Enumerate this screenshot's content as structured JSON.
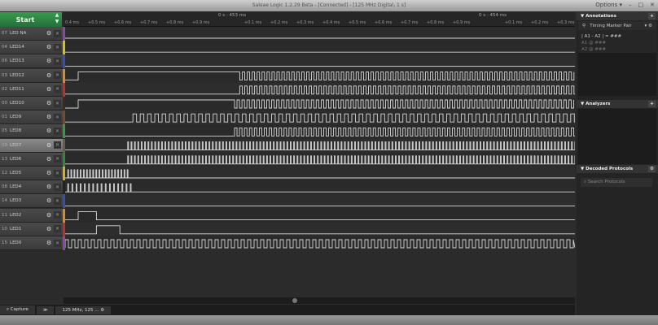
{
  "window": {
    "title": "Saleae Logic 1.2.29 Beta - [Connected] - [125 MHz Digital, 1 s]",
    "options_label": "Options ▾",
    "minimize": "–",
    "maximize": "□",
    "close": "✕"
  },
  "start_button": {
    "label": "Start"
  },
  "ruler": {
    "markers": [
      "0 s : 453 ms",
      "0 s : 454 ms"
    ],
    "ticks": [
      "0.4 ms",
      "+0.5 ms",
      "+0.6 ms",
      "+0.7 ms",
      "+0.8 ms",
      "+0.9 ms",
      "+0.1 ms",
      "+0.2 ms",
      "+0.3 ms",
      "+0.4 ms",
      "+0.5 ms",
      "+0.6 ms",
      "+0.7 ms",
      "+0.8 ms",
      "+0.9 ms",
      "+0.1 ms",
      "+0.2 ms",
      "+0.3 ms"
    ]
  },
  "channels": [
    {
      "num": "07",
      "name": "LED NA",
      "color": "#8e44ad",
      "wave": {
        "kind": "flat"
      }
    },
    {
      "num": "04",
      "name": "LED14",
      "color": "#d4c21a",
      "wave": {
        "kind": "flat"
      }
    },
    {
      "num": "06",
      "name": "LED13",
      "color": "#3050c0",
      "wave": {
        "kind": "flat"
      }
    },
    {
      "num": "03",
      "name": "LED12",
      "color": "#e08a1a",
      "wave": {
        "kind": "step_clock",
        "step_ms": 0.45,
        "clock_from_ms": 1.07,
        "period_ms": 0.019
      }
    },
    {
      "num": "02",
      "name": "LED11",
      "color": "#c0302a",
      "wave": {
        "kind": "clock",
        "from_ms": 1.07,
        "to_ms": 2.4,
        "period_ms": 0.019
      }
    },
    {
      "num": "00",
      "name": "LED10",
      "color": "#3a2a20",
      "wave": {
        "kind": "step_clock",
        "step_ms": 0.45,
        "clock_from_ms": 1.05,
        "period_ms": 0.019
      }
    },
    {
      "num": "01",
      "name": "LED9",
      "color": "#7a4a2a",
      "wave": {
        "kind": "clock",
        "from_ms": 0.66,
        "to_ms": 2.4,
        "period_ms": 0.028
      }
    },
    {
      "num": "05",
      "name": "LED8",
      "color": "#3a9a3a",
      "wave": {
        "kind": "clock",
        "from_ms": 1.05,
        "to_ms": 2.4,
        "period_ms": 0.019
      }
    },
    {
      "num": "09",
      "name": "LED7",
      "color": "#6a5a4a",
      "selected": true,
      "wave": {
        "kind": "pulses",
        "from_ms": 0.64,
        "to_ms": 2.4,
        "period_ms": 0.013
      }
    },
    {
      "num": "13",
      "name": "LED6",
      "color": "#2e8a3a",
      "wave": {
        "kind": "pulses",
        "from_ms": 0.64,
        "to_ms": 2.4,
        "period_ms": 0.013
      }
    },
    {
      "num": "12",
      "name": "LED5",
      "color": "#d4b21a",
      "wave": {
        "kind": "pulses",
        "from_ms": 0.41,
        "to_ms": 0.65,
        "period_ms": 0.012
      }
    },
    {
      "num": "08",
      "name": "LED4",
      "color": "#222222",
      "wave": {
        "kind": "pulses",
        "from_ms": 0.41,
        "to_ms": 0.65,
        "period_ms": 0.016
      }
    },
    {
      "num": "14",
      "name": "LED3",
      "color": "#3050c0",
      "wave": {
        "kind": "flat"
      }
    },
    {
      "num": "11",
      "name": "LED2",
      "color": "#e08a1a",
      "wave": {
        "kind": "pulse",
        "from_ms": 0.45,
        "to_ms": 0.52
      }
    },
    {
      "num": "10",
      "name": "LED1",
      "color": "#c0302a",
      "wave": {
        "kind": "pulse",
        "from_ms": 0.52,
        "to_ms": 0.61
      }
    },
    {
      "num": "15",
      "name": "LED0",
      "color": "#8e44ad",
      "wave": {
        "kind": "clock",
        "from_ms": 0.4,
        "to_ms": 2.4,
        "period_ms": 0.025
      }
    }
  ],
  "footer": {
    "capture_tab": "Capture",
    "more": "≫",
    "session_tab": "125 MHz, 125 ..."
  },
  "annotations": {
    "title": "Annotations",
    "add": "+",
    "marker_pair": "Timing Marker Pair",
    "formula": "| A1 - A2 | = ###",
    "a1": "A1  @  ###",
    "a2": "A2  @  ###"
  },
  "analyzers": {
    "title": "Analyzers",
    "add": "+"
  },
  "decoded": {
    "title": "Decoded Protocols",
    "search_placeholder": "Search Protocols"
  }
}
